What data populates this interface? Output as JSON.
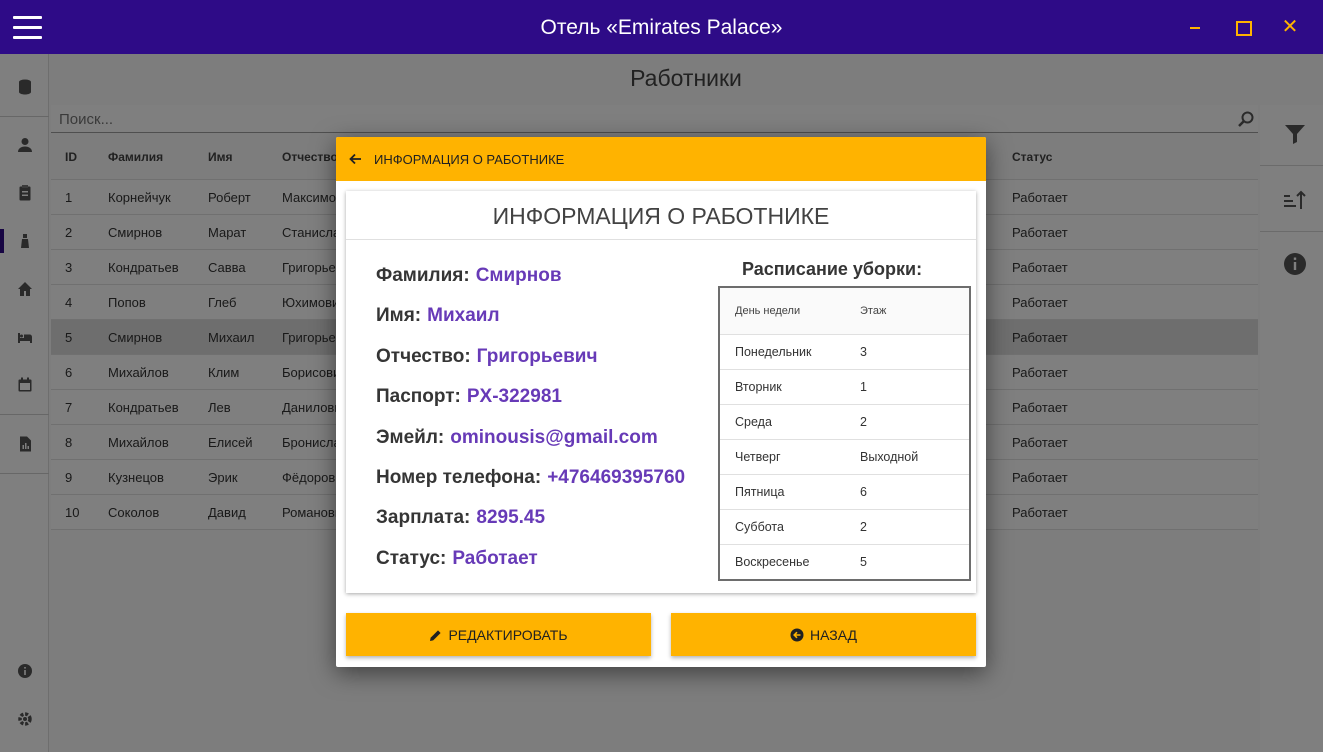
{
  "window": {
    "title": "Отель «Emirates Palace»"
  },
  "page": {
    "title": "Работники",
    "search_placeholder": "Поиск..."
  },
  "table": {
    "headers": {
      "id": "ID",
      "last_name": "Фамилия",
      "first_name": "Имя",
      "patronymic": "Отчество",
      "status": "Статус"
    },
    "rows": [
      {
        "id": "1",
        "last_name": "Корнейчук",
        "first_name": "Роберт",
        "patronymic": "Максимович",
        "status": "Работает"
      },
      {
        "id": "2",
        "last_name": "Смирнов",
        "first_name": "Марат",
        "patronymic": "Станиславович",
        "status": "Работает"
      },
      {
        "id": "3",
        "last_name": "Кондратьев",
        "first_name": "Савва",
        "patronymic": "Григорьевич",
        "status": "Работает"
      },
      {
        "id": "4",
        "last_name": "Попов",
        "first_name": "Глеб",
        "patronymic": "Юхимович",
        "status": "Работает"
      },
      {
        "id": "5",
        "last_name": "Смирнов",
        "first_name": "Михаил",
        "patronymic": "Григорьевич",
        "status": "Работает"
      },
      {
        "id": "6",
        "last_name": "Михайлов",
        "first_name": "Клим",
        "patronymic": "Борисович",
        "status": "Работает"
      },
      {
        "id": "7",
        "last_name": "Кондратьев",
        "first_name": "Лев",
        "patronymic": "Данилович",
        "status": "Работает"
      },
      {
        "id": "8",
        "last_name": "Михайлов",
        "first_name": "Елисей",
        "patronymic": "Брониславович",
        "status": "Работает"
      },
      {
        "id": "9",
        "last_name": "Кузнецов",
        "first_name": "Эрик",
        "patronymic": "Фёдорович",
        "status": "Работает"
      },
      {
        "id": "10",
        "last_name": "Соколов",
        "first_name": "Давид",
        "patronymic": "Романович",
        "status": "Работает"
      }
    ]
  },
  "dialog": {
    "header_title": "ИНФОРМАЦИЯ О РАБОТНИКЕ",
    "card_title": "ИНФОРМАЦИЯ О РАБОТНИКЕ",
    "fields": [
      {
        "label": "Фамилия:",
        "value": "Смирнов"
      },
      {
        "label": "Имя:",
        "value": "Михаил"
      },
      {
        "label": "Отчество:",
        "value": "Григорьевич"
      },
      {
        "label": "Паспорт:",
        "value": "PX-322981"
      },
      {
        "label": "Эмейл:",
        "value": "ominousis@gmail.com"
      },
      {
        "label": "Номер телефона:",
        "value": "+476469395760"
      },
      {
        "label": "Зарплата:",
        "value": "8295.45"
      },
      {
        "label": "Статус:",
        "value": "Работает"
      }
    ],
    "schedule": {
      "title": "Расписание уборки:",
      "headers": {
        "day": "День недели",
        "floor": "Этаж"
      },
      "rows": [
        {
          "day": "Понедельник",
          "floor": "3"
        },
        {
          "day": "Вторник",
          "floor": "1"
        },
        {
          "day": "Среда",
          "floor": "2"
        },
        {
          "day": "Четверг",
          "floor": "Выходной"
        },
        {
          "day": "Пятница",
          "floor": "6"
        },
        {
          "day": "Суббота",
          "floor": "2"
        },
        {
          "day": "Воскресенье",
          "floor": "5"
        }
      ]
    },
    "edit_label": "РЕДАКТИРОВАТЬ",
    "back_label": "НАЗАД"
  },
  "colors": {
    "titlebar": "#2e0b87",
    "accent": "#ffb300",
    "value_text": "#673ab7"
  },
  "icons": {
    "sidebar": [
      "database-icon",
      "person-icon",
      "clipboard-icon",
      "worker-icon",
      "home-icon",
      "bed-icon",
      "calendar-icon",
      "report-icon",
      "info-icon",
      "settings-icon"
    ],
    "tools": [
      "filter-icon",
      "sort-icon",
      "info-icon"
    ]
  }
}
